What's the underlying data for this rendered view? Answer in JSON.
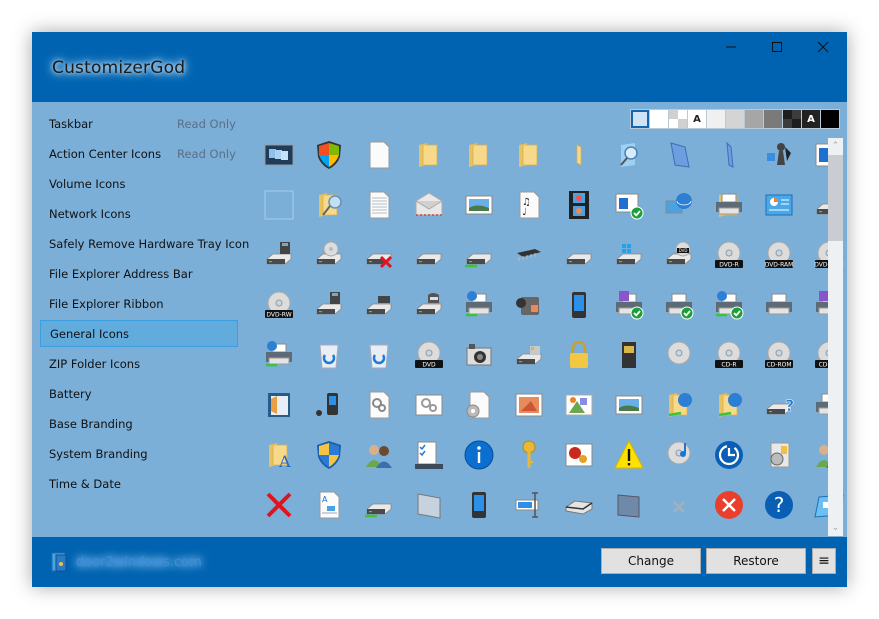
{
  "window": {
    "title": "CustomizerGod",
    "controls": {
      "minimize": "minimize-icon",
      "maximize": "maximize-icon",
      "close": "close-icon"
    }
  },
  "sidebar": {
    "items": [
      {
        "label": "Taskbar",
        "status": "Read Only"
      },
      {
        "label": "Action Center Icons",
        "status": "Read Only"
      },
      {
        "label": "Volume Icons",
        "status": ""
      },
      {
        "label": "Network Icons",
        "status": ""
      },
      {
        "label": "Safely Remove Hardware Tray Icon",
        "status": ""
      },
      {
        "label": "File Explorer Address Bar",
        "status": ""
      },
      {
        "label": "File Explorer Ribbon",
        "status": ""
      },
      {
        "label": "General Icons",
        "status": "",
        "selected": true
      },
      {
        "label": "ZIP Folder Icons",
        "status": ""
      },
      {
        "label": "Battery",
        "status": ""
      },
      {
        "label": "Base Branding",
        "status": ""
      },
      {
        "label": "System Branding",
        "status": ""
      },
      {
        "label": "Time & Date",
        "status": ""
      }
    ]
  },
  "background_swatches": [
    {
      "name": "light-blue",
      "color": "#cfe3f7",
      "selected": true
    },
    {
      "name": "white",
      "color": "#ffffff"
    },
    {
      "name": "checker-light",
      "color": "#e6e6e6"
    },
    {
      "name": "text-on-light",
      "color": "#ffffff",
      "glyph": "A"
    },
    {
      "name": "very-light-gray",
      "color": "#f0f0f0"
    },
    {
      "name": "light-gray",
      "color": "#d4d4d4"
    },
    {
      "name": "gray",
      "color": "#a6a6a6"
    },
    {
      "name": "dark-gray",
      "color": "#7a7a7a"
    },
    {
      "name": "checker-dark",
      "color": "#2e2e2e"
    },
    {
      "name": "text-on-dark",
      "color": "#222222",
      "glyph": "A"
    },
    {
      "name": "black",
      "color": "#000000"
    }
  ],
  "icons": [
    [
      "taskbar-thumbnails-icon",
      "windows-shield-icon",
      "blank-document-icon",
      "folder-icon",
      "folder-open-icon",
      "folder-small-icon",
      "folder-narrow-icon",
      "search-folder-icon",
      "library-icon",
      "library-narrow-icon",
      "puzzle-chess-icon",
      "window-app-icon"
    ],
    [
      "empty-placeholder-icon",
      "folder-search-icon",
      "text-document-icon",
      "envelope-icon",
      "picture-frame-icon",
      "music-sheet-icon",
      "film-strip-icon",
      "window-check-icon",
      "network-globe-icon",
      "printer-folder-icon",
      "control-panel-icon",
      "floppy-drive-icon"
    ],
    [
      "floppy-drive-icon",
      "cd-drive-icon",
      "drive-error-icon",
      "hard-drive-icon",
      "network-drive-icon",
      "memory-chip-icon",
      "hard-drive-icon",
      "windows-drive-icon",
      "dvd-drive-icon",
      "dvd-r-icon",
      "dvd-ram-icon",
      "dvd-rom-icon"
    ],
    [
      "dvd-rw-icon",
      "floppy-drive-icon",
      "tape-drive-icon",
      "removable-drive-icon",
      "network-printer-icon",
      "camcorder-icon",
      "mobile-phone-icon",
      "fax-printer-check-icon",
      "printer-check-icon",
      "network-printer-check-icon",
      "printer-icon",
      "fax-printer-icon"
    ],
    [
      "network-printer-icon",
      "recycle-bin-full-icon",
      "recycle-bin-empty-icon",
      "dvd-disc-icon",
      "camera-icon",
      "card-reader-icon",
      "lock-icon",
      "sd-card-icon",
      "cd-disc-icon",
      "cd-r-icon",
      "cd-rom-icon",
      "cd-rw-icon"
    ],
    [
      "contact-card-icon",
      "media-player-icon",
      "settings-file-icon",
      "settings-window-icon",
      "gear-document-icon",
      "image-file-icon",
      "image-collage-icon",
      "landscape-picture-icon",
      "network-folder-icon",
      "network-folder-share-icon",
      "drive-help-icon",
      "printer-fax-icon"
    ],
    [
      "font-folder-icon",
      "uac-shield-icon",
      "users-icon",
      "task-list-icon",
      "info-icon",
      "key-icon",
      "photo-flowers-icon",
      "warning-icon",
      "music-cd-icon",
      "clock-sync-icon",
      "software-box-icon",
      "user-group-icon"
    ],
    [
      "error-x-icon",
      "rich-text-document-icon",
      "drive-network-icon",
      "panel-device-icon",
      "pda-icon",
      "text-cursor-field-icon",
      "scanner-icon",
      "tablet-device-icon",
      "small-x-icon",
      "error-circle-icon",
      "help-circle-icon",
      "screen-slide-icon"
    ]
  ],
  "footer": {
    "brand_text": "door2windows.com",
    "change_label": "Change",
    "restore_label": "Restore",
    "menu_glyph": "≡"
  }
}
